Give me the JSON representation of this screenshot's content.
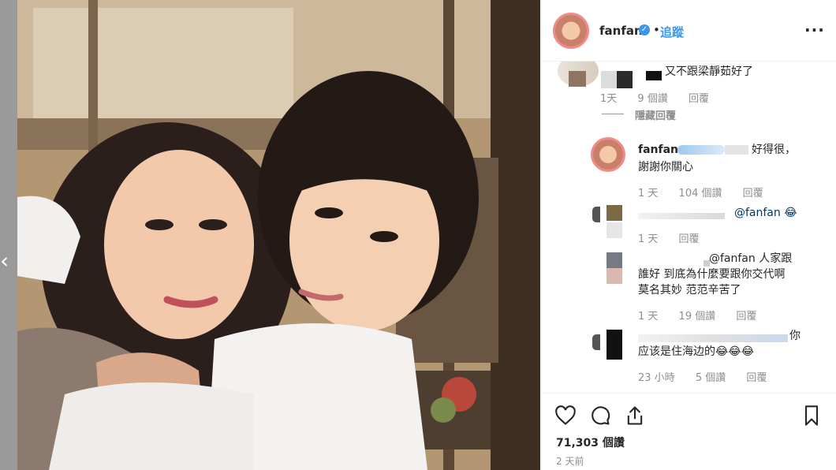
{
  "post": {
    "username": "fanfan",
    "verified_icon": "verified-badge-icon",
    "separator": "•",
    "follow_label": "追蹤",
    "more_icon": "more-options-icon",
    "more_label": "···"
  },
  "comments": [
    {
      "text": "又不跟梁靜茹好了",
      "meta_time": "1天",
      "meta_likes": "9 個讚",
      "meta_reply": "回覆",
      "hide_replies": "隱藏回覆"
    },
    {
      "username": "fanfan",
      "text_line1": "好得很，",
      "text_line2": "謝謝你關心",
      "meta_time": "1 天",
      "meta_likes": "104 個讚",
      "meta_reply": "回覆"
    },
    {
      "text": "@fanfan 😂",
      "meta_time": "1 天",
      "meta_reply": "回覆"
    },
    {
      "text_line1": "@fanfan 人家跟",
      "text_line2": "誰好 到底為什麼要跟你交代啊",
      "text_line3": "莫名其妙 范范辛苦了",
      "meta_time": "1 天",
      "meta_likes": "19 個讚",
      "meta_reply": "回覆"
    },
    {
      "text_line1": "你",
      "text_line2": "应该是住海边的😂😂😂",
      "meta_time": "23 小時",
      "meta_likes": "5 個讚",
      "meta_reply": "回覆"
    }
  ],
  "actions": {
    "like_icon": "heart-icon",
    "comment_icon": "comment-icon",
    "share_icon": "share-icon",
    "save_icon": "bookmark-icon",
    "likes_count": "71,303 個讚",
    "time_ago": "2 天前"
  },
  "navigation": {
    "prev_icon": "chevron-left-icon",
    "prev_label": "‹"
  }
}
